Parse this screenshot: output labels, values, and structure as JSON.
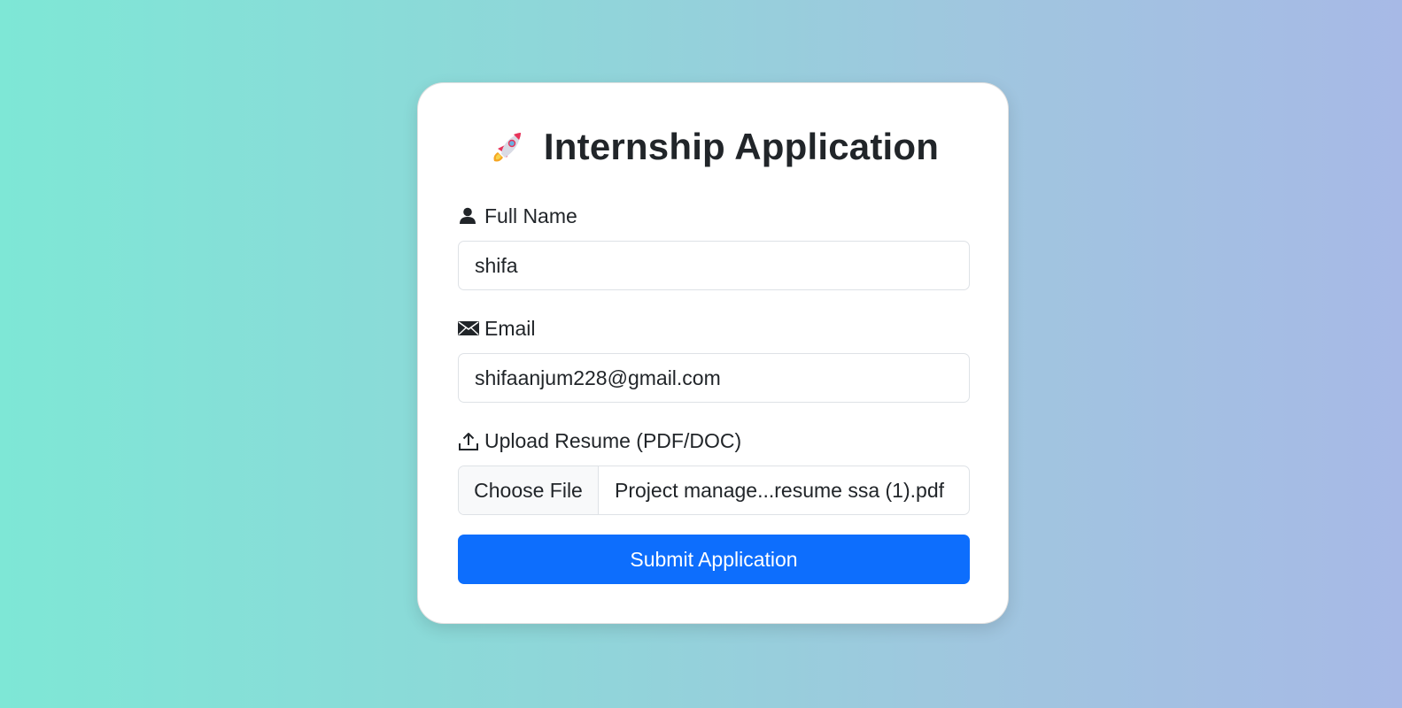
{
  "form": {
    "title": "Internship Application",
    "title_icon": "rocket-icon",
    "full_name": {
      "label": "Full Name",
      "icon": "person-icon",
      "value": "shifa"
    },
    "email": {
      "label": "Email",
      "icon": "envelope-icon",
      "value": "shifaanjum228@gmail.com"
    },
    "resume": {
      "label": "Upload Resume (PDF/DOC)",
      "icon": "upload-icon",
      "button_label": "Choose File",
      "file_name": "Project manage...resume  ssa (1).pdf"
    },
    "submit_label": "Submit Application"
  },
  "colors": {
    "primary": "#0d6efd",
    "background_start": "#7ee7d6",
    "background_end": "#a7b9e6"
  }
}
